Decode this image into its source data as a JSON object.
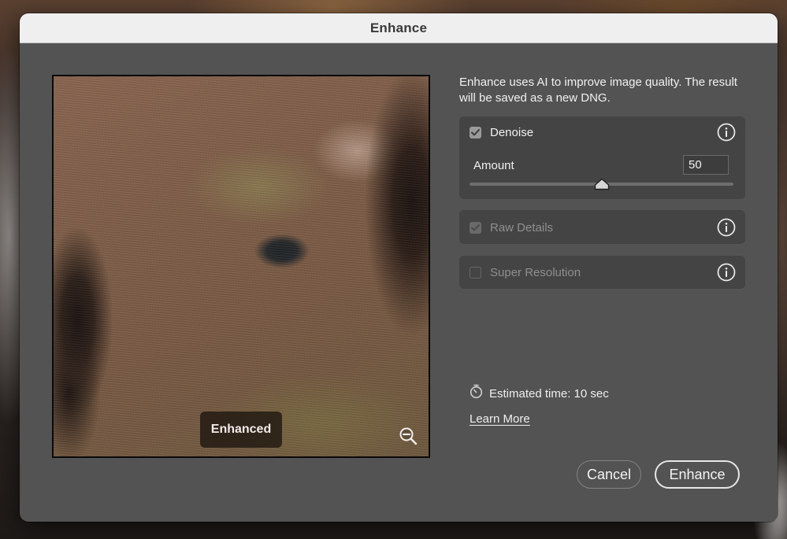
{
  "dialog": {
    "title": "Enhance"
  },
  "preview": {
    "badge_label": "Enhanced",
    "zoom_icon": "zoom-out-icon"
  },
  "panel": {
    "description": "Enhance uses AI to improve image quality. The result will be saved as a new DNG.",
    "options": [
      {
        "label": "Denoise",
        "checked": true,
        "enabled": true,
        "icon": "info-icon"
      },
      {
        "label": "Raw Details",
        "checked": true,
        "enabled": false,
        "icon": "info-icon"
      },
      {
        "label": "Super Resolution",
        "checked": false,
        "enabled": false,
        "icon": "info-icon"
      }
    ],
    "amount": {
      "label": "Amount",
      "value": "50",
      "min": 0,
      "max": 100
    },
    "estimated_time": "Estimated time: 10 sec",
    "estimated_icon": "stopwatch-icon",
    "learn_more": "Learn More"
  },
  "buttons": {
    "cancel": "Cancel",
    "enhance": "Enhance"
  },
  "colors": {
    "dialog_bg": "#535353",
    "card_bg": "#444444",
    "titlebar_bg": "#efefef"
  }
}
